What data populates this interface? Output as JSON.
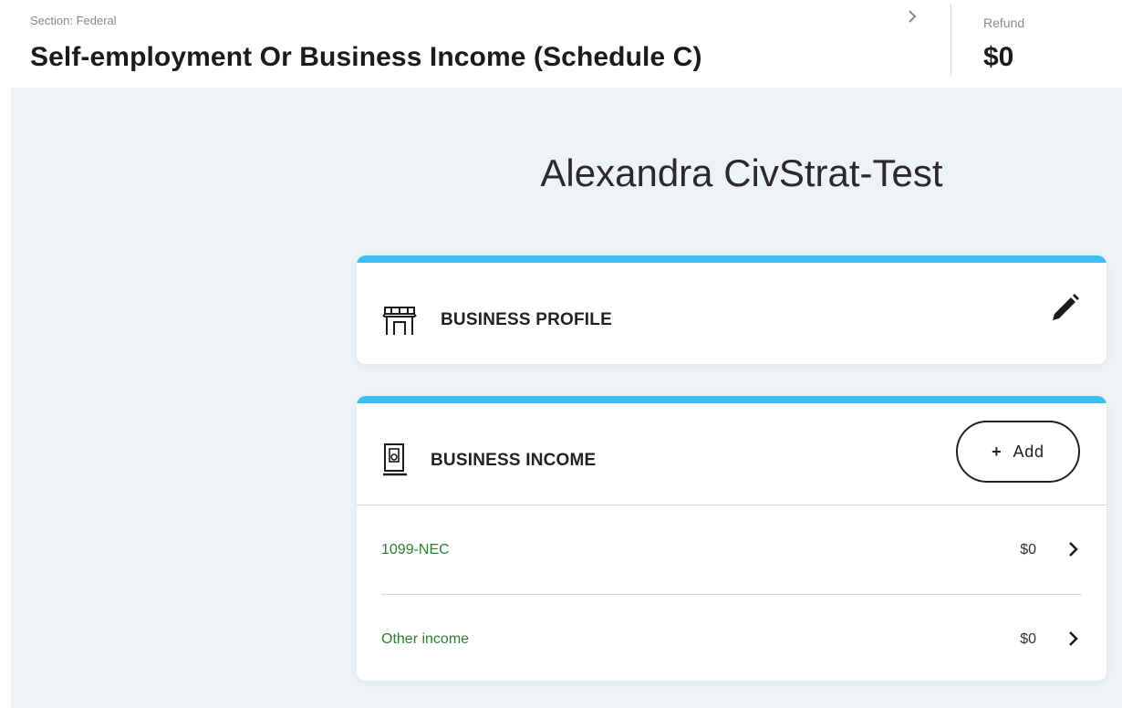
{
  "header": {
    "section_label": "Section: Federal",
    "title": "Self-employment Or Business Income (Schedule C)",
    "refund_label": "Refund",
    "refund_value": "$0"
  },
  "person_name": "Alexandra CivStrat-Test",
  "profile_card": {
    "title": "BUSINESS PROFILE",
    "icon": "storefront-icon",
    "edit_icon": "pencil-icon"
  },
  "income_card": {
    "title": "BUSINESS INCOME",
    "icon": "building-icon",
    "add_label": "Add",
    "add_plus": "+",
    "rows": [
      {
        "label": "1099-NEC",
        "amount": "$0"
      },
      {
        "label": "Other income",
        "amount": "$0"
      }
    ]
  },
  "colors": {
    "accent_bar": "#3dbff3",
    "link_green": "#2e7d32",
    "background": "#eff3f7"
  }
}
